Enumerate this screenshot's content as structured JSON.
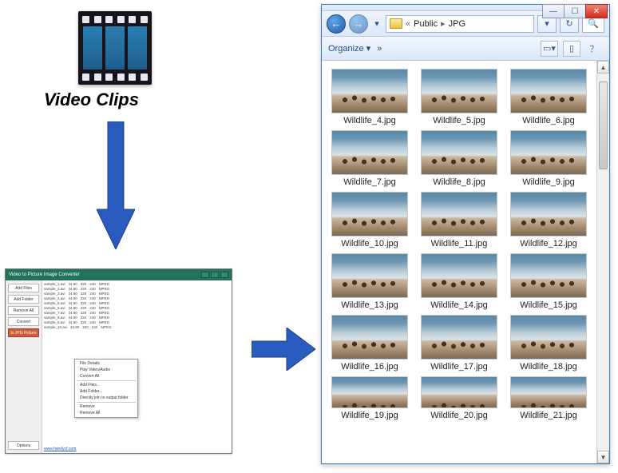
{
  "filmLabel": "Video Clips",
  "converter": {
    "title": "Video to Picture Image Converter",
    "sideButtons": [
      "Add Files",
      "Add Folder",
      "Remove All",
      "Convert",
      "to JPG Picture",
      "Options"
    ],
    "activeIndex": 4,
    "contextMenu": [
      "File Details",
      "Play Video/Audio",
      "Convert All",
      "Add Files...",
      "Add Folder...",
      "Directly join to output folder",
      "Remove",
      "Remove All"
    ],
    "footerLink": "www.handycf.com"
  },
  "explorer": {
    "winbtns": {
      "min": "—",
      "max": "☐",
      "close": "✕"
    },
    "crumbs": [
      "Public",
      "JPG"
    ],
    "toolbar": {
      "organize": "Organize",
      "more": "»"
    },
    "files": [
      "Wildlife_4.jpg",
      "Wildlife_5.jpg",
      "Wildlife_6.jpg",
      "Wildlife_7.jpg",
      "Wildlife_8.jpg",
      "Wildlife_9.jpg",
      "Wildlife_10.jpg",
      "Wildlife_11.jpg",
      "Wildlife_12.jpg",
      "Wildlife_13.jpg",
      "Wildlife_14.jpg",
      "Wildlife_15.jpg",
      "Wildlife_16.jpg",
      "Wildlife_17.jpg",
      "Wildlife_18.jpg",
      "Wildlife_19.jpg",
      "Wildlife_20.jpg",
      "Wildlife_21.jpg"
    ]
  }
}
